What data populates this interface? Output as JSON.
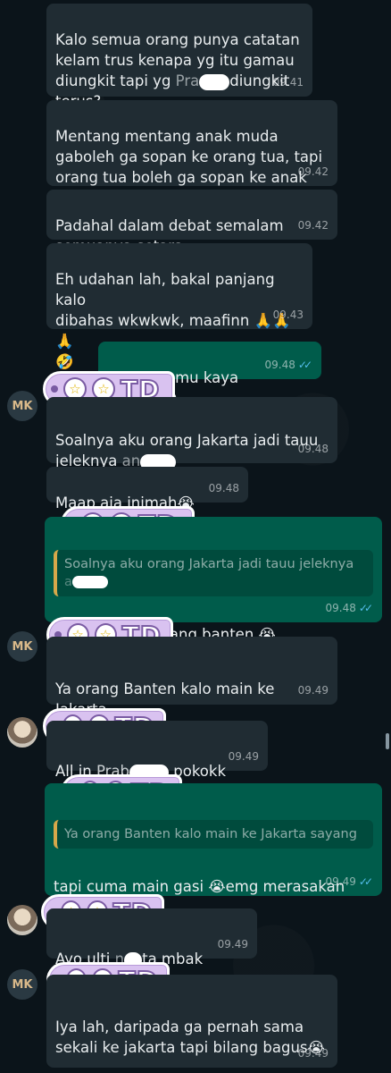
{
  "messages": [
    {
      "text": "Kalo semua orang punya catatan kelam trus kenapa yg itu gamau diungkit tapi yg Prabowo diungkit terus?",
      "time": "09.41"
    },
    {
      "text": "Mentang mentang anak muda gaboleh ga sopan ke orang tua, tapi orang tua boleh ga sopan ke anak muda",
      "time": "09.42"
    },
    {
      "text": "Padahal dalam debat semalam semuanya setara",
      "time": "09.42"
    },
    {
      "text": "Eh udahan lah, bakal panjang kalo dibahas wkwkwk, maafinn 🙏🙏🙏 🤣",
      "time": "09.43"
    },
    {
      "text": "mbak, kamu kaya buzzer 😭",
      "time": "09.48"
    },
    {
      "text": "Soalnya aku orang Jakarta jadi tauu jeleknya anjir",
      "time": "09.48"
    },
    {
      "text": "Maap aja inimah😭",
      "time": "09.48"
    },
    {
      "quote": "Soalnya aku orang Jakarta jadi tauu jeleknya anjir",
      "text": "tpi kamu kan orang banten 😭",
      "time": "09.48"
    },
    {
      "text": "Ya orang Banten kalo main ke Jakarta sayang",
      "time": "09.49"
    },
    {
      "text": "All in Prabowo pokokk",
      "time": "09.49"
    },
    {
      "quote": "Ya orang Banten kalo main ke Jakarta sayang",
      "text": "tapi cuma main gasi 😭emg merasakan ya?",
      "time": "09.49"
    },
    {
      "text": "Ayo ulti nenta mbak",
      "time": "09.49"
    },
    {
      "text": "Iya lah, daripada ga pernah sama sekali ke jakarta tapi bilang bagus😭",
      "time": "09.49"
    }
  ],
  "sender_initials": "MK",
  "sticker_label": "TD",
  "sticker_star": "☆",
  "colors": {
    "incoming": "#202c33",
    "outgoing": "#005c4b",
    "read_ticks": "#53bdeb",
    "quote_bar": "#d6a84a"
  }
}
